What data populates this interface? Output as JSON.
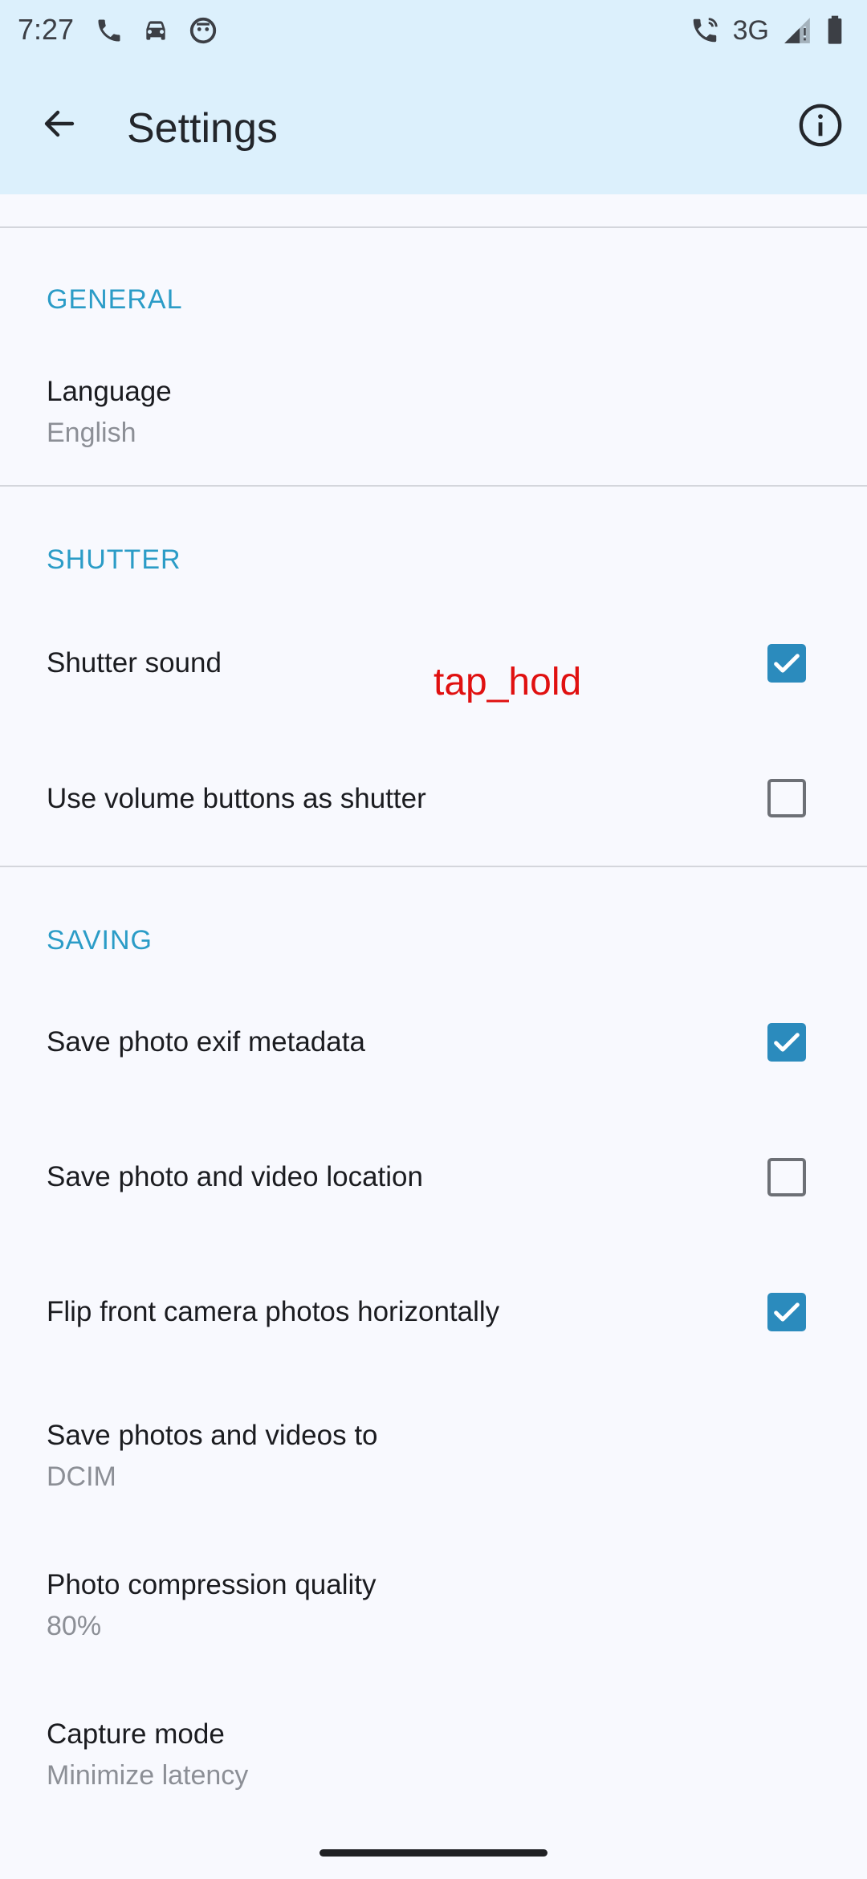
{
  "status_bar": {
    "time": "7:27",
    "network": "3G",
    "left_icons": [
      "phone-icon",
      "car-icon",
      "face-icon"
    ],
    "right_icons": [
      "call-volte-icon",
      "signal-icon",
      "battery-icon"
    ]
  },
  "app_bar": {
    "title": "Settings",
    "back_icon": "arrow-back-icon",
    "info_icon": "info-icon"
  },
  "sections": {
    "general": {
      "header": "GENERAL",
      "language": {
        "title": "Language",
        "summary": "English"
      }
    },
    "shutter": {
      "header": "SHUTTER",
      "shutter_sound": {
        "title": "Shutter sound",
        "checked": true
      },
      "volume_buttons": {
        "title": "Use volume buttons as shutter",
        "checked": false
      }
    },
    "saving": {
      "header": "SAVING",
      "exif": {
        "title": "Save photo exif metadata",
        "checked": true
      },
      "location": {
        "title": "Save photo and video location",
        "checked": false
      },
      "flip_front": {
        "title": "Flip front camera photos horizontally",
        "checked": true
      },
      "save_to": {
        "title": "Save photos and videos to",
        "summary": "DCIM"
      },
      "compression": {
        "title": "Photo compression quality",
        "summary": "80%"
      },
      "capture_mode": {
        "title": "Capture mode",
        "summary": "Minimize latency"
      }
    }
  },
  "annotation": "tap_hold",
  "colors": {
    "app_bar_bg": "#dcf0fc",
    "accent": "#2b8bbd",
    "section_header": "#2b9cc7",
    "annotation": "#e01010"
  }
}
